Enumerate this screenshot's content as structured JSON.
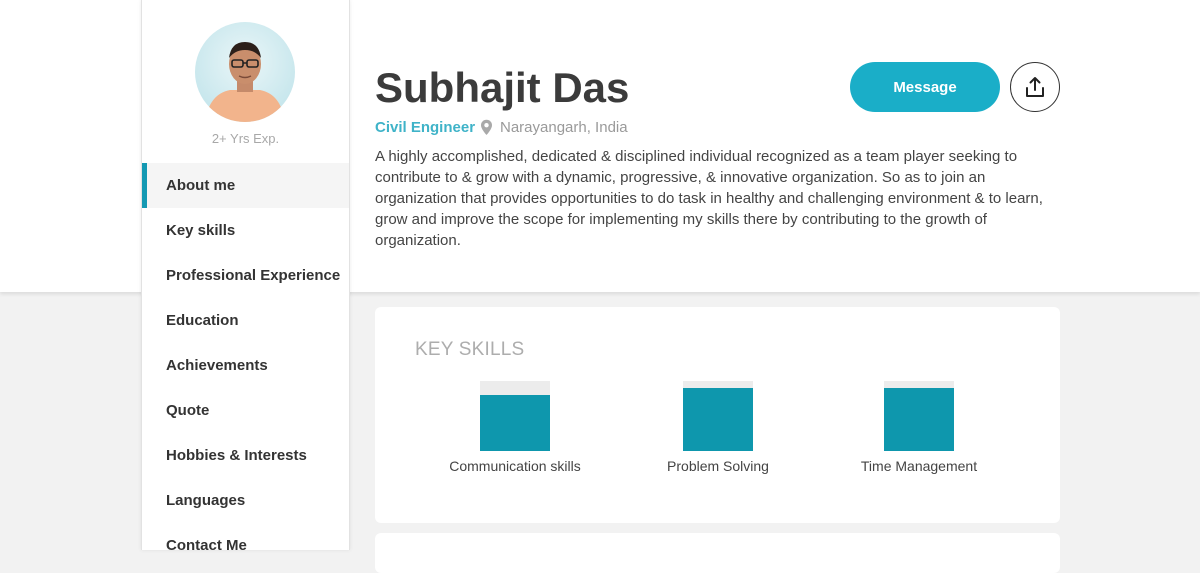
{
  "profile": {
    "experience": "2+ Yrs Exp.",
    "name": "Subhajit Das",
    "role": "Civil Engineer",
    "location": "Narayangarh, India",
    "bio": "A highly accomplished, dedicated & disciplined individual recognized as a team player seeking to contribute to & grow with a dynamic, progressive, & innovative organization. So as to join an organization that provides opportunities to do task in healthy and challenging environment & to learn, grow and improve the scope for implementing my skills there by contributing to the growth of organization."
  },
  "actions": {
    "message_label": "Message",
    "share_icon": "share-upload-icon"
  },
  "nav": {
    "items": [
      {
        "label": "About me",
        "active": true
      },
      {
        "label": "Key skills"
      },
      {
        "label": "Professional Experience"
      },
      {
        "label": "Education"
      },
      {
        "label": "Achievements"
      },
      {
        "label": "Quote"
      },
      {
        "label": "Hobbies & Interests"
      },
      {
        "label": "Languages"
      },
      {
        "label": "Contact Me"
      }
    ]
  },
  "skills_card": {
    "title": "KEY SKILLS",
    "skills": [
      {
        "label": "Communication skills",
        "level": 0.8
      },
      {
        "label": "Problem Solving",
        "level": 0.9
      },
      {
        "label": "Time Management",
        "level": 0.9
      }
    ]
  },
  "colors": {
    "accent": "#1aaec8",
    "skill_fill": "#0e97ad",
    "role_text": "#3fb3c8"
  },
  "icons": {
    "location": "map-pin-icon",
    "share": "share-upload-icon"
  }
}
